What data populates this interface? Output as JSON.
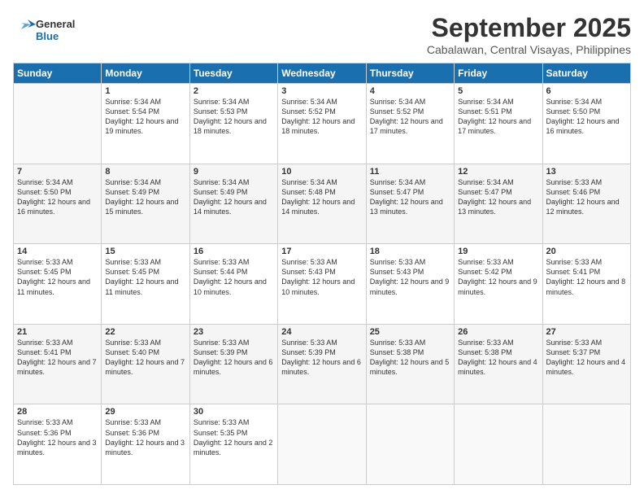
{
  "logo": {
    "line1": "General",
    "line2": "Blue"
  },
  "title": "September 2025",
  "location": "Cabalawan, Central Visayas, Philippines",
  "headers": [
    "Sunday",
    "Monday",
    "Tuesday",
    "Wednesday",
    "Thursday",
    "Friday",
    "Saturday"
  ],
  "weeks": [
    [
      {
        "day": "",
        "sunrise": "",
        "sunset": "",
        "daylight": ""
      },
      {
        "day": "1",
        "sunrise": "Sunrise: 5:34 AM",
        "sunset": "Sunset: 5:54 PM",
        "daylight": "Daylight: 12 hours and 19 minutes."
      },
      {
        "day": "2",
        "sunrise": "Sunrise: 5:34 AM",
        "sunset": "Sunset: 5:53 PM",
        "daylight": "Daylight: 12 hours and 18 minutes."
      },
      {
        "day": "3",
        "sunrise": "Sunrise: 5:34 AM",
        "sunset": "Sunset: 5:52 PM",
        "daylight": "Daylight: 12 hours and 18 minutes."
      },
      {
        "day": "4",
        "sunrise": "Sunrise: 5:34 AM",
        "sunset": "Sunset: 5:52 PM",
        "daylight": "Daylight: 12 hours and 17 minutes."
      },
      {
        "day": "5",
        "sunrise": "Sunrise: 5:34 AM",
        "sunset": "Sunset: 5:51 PM",
        "daylight": "Daylight: 12 hours and 17 minutes."
      },
      {
        "day": "6",
        "sunrise": "Sunrise: 5:34 AM",
        "sunset": "Sunset: 5:50 PM",
        "daylight": "Daylight: 12 hours and 16 minutes."
      }
    ],
    [
      {
        "day": "7",
        "sunrise": "Sunrise: 5:34 AM",
        "sunset": "Sunset: 5:50 PM",
        "daylight": "Daylight: 12 hours and 16 minutes."
      },
      {
        "day": "8",
        "sunrise": "Sunrise: 5:34 AM",
        "sunset": "Sunset: 5:49 PM",
        "daylight": "Daylight: 12 hours and 15 minutes."
      },
      {
        "day": "9",
        "sunrise": "Sunrise: 5:34 AM",
        "sunset": "Sunset: 5:49 PM",
        "daylight": "Daylight: 12 hours and 14 minutes."
      },
      {
        "day": "10",
        "sunrise": "Sunrise: 5:34 AM",
        "sunset": "Sunset: 5:48 PM",
        "daylight": "Daylight: 12 hours and 14 minutes."
      },
      {
        "day": "11",
        "sunrise": "Sunrise: 5:34 AM",
        "sunset": "Sunset: 5:47 PM",
        "daylight": "Daylight: 12 hours and 13 minutes."
      },
      {
        "day": "12",
        "sunrise": "Sunrise: 5:34 AM",
        "sunset": "Sunset: 5:47 PM",
        "daylight": "Daylight: 12 hours and 13 minutes."
      },
      {
        "day": "13",
        "sunrise": "Sunrise: 5:33 AM",
        "sunset": "Sunset: 5:46 PM",
        "daylight": "Daylight: 12 hours and 12 minutes."
      }
    ],
    [
      {
        "day": "14",
        "sunrise": "Sunrise: 5:33 AM",
        "sunset": "Sunset: 5:45 PM",
        "daylight": "Daylight: 12 hours and 11 minutes."
      },
      {
        "day": "15",
        "sunrise": "Sunrise: 5:33 AM",
        "sunset": "Sunset: 5:45 PM",
        "daylight": "Daylight: 12 hours and 11 minutes."
      },
      {
        "day": "16",
        "sunrise": "Sunrise: 5:33 AM",
        "sunset": "Sunset: 5:44 PM",
        "daylight": "Daylight: 12 hours and 10 minutes."
      },
      {
        "day": "17",
        "sunrise": "Sunrise: 5:33 AM",
        "sunset": "Sunset: 5:43 PM",
        "daylight": "Daylight: 12 hours and 10 minutes."
      },
      {
        "day": "18",
        "sunrise": "Sunrise: 5:33 AM",
        "sunset": "Sunset: 5:43 PM",
        "daylight": "Daylight: 12 hours and 9 minutes."
      },
      {
        "day": "19",
        "sunrise": "Sunrise: 5:33 AM",
        "sunset": "Sunset: 5:42 PM",
        "daylight": "Daylight: 12 hours and 9 minutes."
      },
      {
        "day": "20",
        "sunrise": "Sunrise: 5:33 AM",
        "sunset": "Sunset: 5:41 PM",
        "daylight": "Daylight: 12 hours and 8 minutes."
      }
    ],
    [
      {
        "day": "21",
        "sunrise": "Sunrise: 5:33 AM",
        "sunset": "Sunset: 5:41 PM",
        "daylight": "Daylight: 12 hours and 7 minutes."
      },
      {
        "day": "22",
        "sunrise": "Sunrise: 5:33 AM",
        "sunset": "Sunset: 5:40 PM",
        "daylight": "Daylight: 12 hours and 7 minutes."
      },
      {
        "day": "23",
        "sunrise": "Sunrise: 5:33 AM",
        "sunset": "Sunset: 5:39 PM",
        "daylight": "Daylight: 12 hours and 6 minutes."
      },
      {
        "day": "24",
        "sunrise": "Sunrise: 5:33 AM",
        "sunset": "Sunset: 5:39 PM",
        "daylight": "Daylight: 12 hours and 6 minutes."
      },
      {
        "day": "25",
        "sunrise": "Sunrise: 5:33 AM",
        "sunset": "Sunset: 5:38 PM",
        "daylight": "Daylight: 12 hours and 5 minutes."
      },
      {
        "day": "26",
        "sunrise": "Sunrise: 5:33 AM",
        "sunset": "Sunset: 5:38 PM",
        "daylight": "Daylight: 12 hours and 4 minutes."
      },
      {
        "day": "27",
        "sunrise": "Sunrise: 5:33 AM",
        "sunset": "Sunset: 5:37 PM",
        "daylight": "Daylight: 12 hours and 4 minutes."
      }
    ],
    [
      {
        "day": "28",
        "sunrise": "Sunrise: 5:33 AM",
        "sunset": "Sunset: 5:36 PM",
        "daylight": "Daylight: 12 hours and 3 minutes."
      },
      {
        "day": "29",
        "sunrise": "Sunrise: 5:33 AM",
        "sunset": "Sunset: 5:36 PM",
        "daylight": "Daylight: 12 hours and 3 minutes."
      },
      {
        "day": "30",
        "sunrise": "Sunrise: 5:33 AM",
        "sunset": "Sunset: 5:35 PM",
        "daylight": "Daylight: 12 hours and 2 minutes."
      },
      {
        "day": "",
        "sunrise": "",
        "sunset": "",
        "daylight": ""
      },
      {
        "day": "",
        "sunrise": "",
        "sunset": "",
        "daylight": ""
      },
      {
        "day": "",
        "sunrise": "",
        "sunset": "",
        "daylight": ""
      },
      {
        "day": "",
        "sunrise": "",
        "sunset": "",
        "daylight": ""
      }
    ]
  ]
}
